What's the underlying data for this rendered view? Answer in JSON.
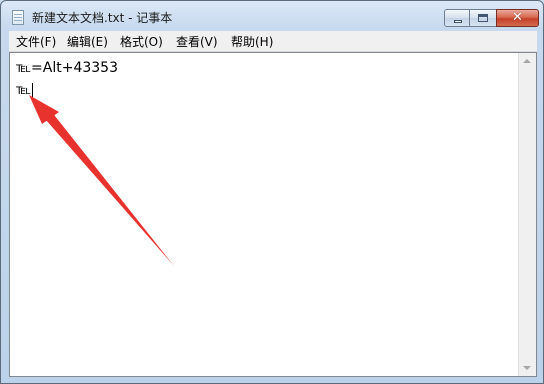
{
  "window": {
    "title": "新建文本文档.txt - 记事本",
    "icon": "notepad-icon",
    "controls": {
      "minimize": "minimize-icon",
      "maximize": "maximize-icon",
      "close_glyph": "✕"
    }
  },
  "menu": {
    "items": [
      {
        "label": "文件(F)"
      },
      {
        "label": "编辑(E)"
      },
      {
        "label": "格式(O)"
      },
      {
        "label": "查看(V)"
      },
      {
        "label": "帮助(H)"
      }
    ]
  },
  "editor": {
    "lines": [
      "℡=Alt+43353",
      "℡"
    ]
  },
  "annotation": {
    "type": "arrow",
    "color": "#e8322e"
  },
  "colors": {
    "close_button": "#c4402a",
    "arrow": "#e8322e",
    "title_bar": "#c7d9ee"
  }
}
